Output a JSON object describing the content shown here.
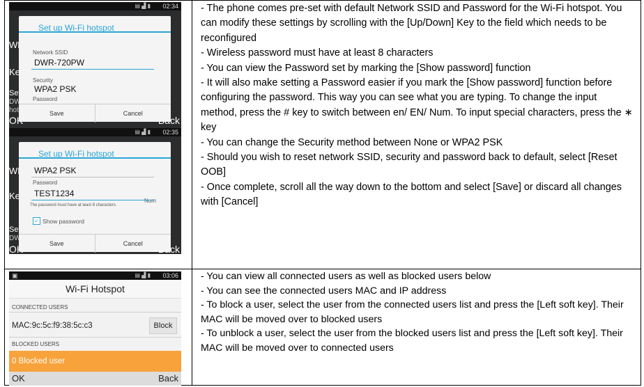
{
  "row1": {
    "paragraphs": [
      "- The phone comes pre-set with default Network SSID and Password for the Wi-Fi hotspot. You can modify these settings by scrolling with the [Up/Down] Key to the field which needs to be reconfigured",
      "- Wireless password must have at least 8 characters",
      "- You can view the Password set by marking the [Show password] function",
      "- It will also make setting a Password easier if you mark the [Show password] function before configuring the password. This way you can see what you are typing. To change the input method, press the # key to switch between en/ EN/ Num. To input special characters, press the ∗ key",
      "- You can change the Security method between None or WPA2 PSK",
      "- Should you wish to reset network SSID, security and password back to default, select [Reset OOB]",
      "- Once complete, scroll all the way down to the bottom and select [Save] or discard all changes with [Cancel]"
    ]
  },
  "row2": {
    "paragraphs": [
      "- You can view all connected users as well as blocked users below",
      "- You can see the connected users MAC and IP address",
      "- To block a user, select the user from the connected users list and press the [Left soft key]. Their MAC will be moved over to blocked users",
      "- To unblock a user, select the user from the blocked users list and press the [Left soft key]. Their MAC will be moved over to connected users"
    ]
  },
  "screen1": {
    "time": "02:34",
    "bg_labels": [
      "WLAN",
      "Keep",
      "Set up",
      "DWR-7",
      "hotspo",
      "OK",
      "Back"
    ],
    "dialog_title": "Set up Wi-Fi hotspot",
    "ssid_label": "Network SSID",
    "ssid_value": "DWR-720PW",
    "security_label": "Security",
    "security_value": "WPA2 PSK",
    "password_label": "Password",
    "save": "Save",
    "cancel": "Cancel"
  },
  "screen2": {
    "time": "02:35",
    "bg_labels": [
      "WLAN",
      "Keep",
      "Set up",
      "DWR-7",
      "OK",
      "Back"
    ],
    "dialog_title": "Set up Wi-Fi hotspot",
    "security_value": "WPA2 PSK",
    "password_label": "Password",
    "password_value": "TEST1234",
    "input_mode": "Num",
    "hint": "The password must have at least 8 characters.",
    "show_password": "Show password",
    "save": "Save",
    "cancel": "Cancel"
  },
  "screen3": {
    "time": "03:06",
    "title": "Wi-Fi Hotspot",
    "connected_header": "CONNECTED USERS",
    "mac": "MAC:9c:5c:f9:38:5c:c3",
    "block": "Block",
    "blocked_header": "BLOCKED USERS",
    "blocked_count": "0 Blocked user",
    "ok": "OK",
    "back": "Back"
  }
}
